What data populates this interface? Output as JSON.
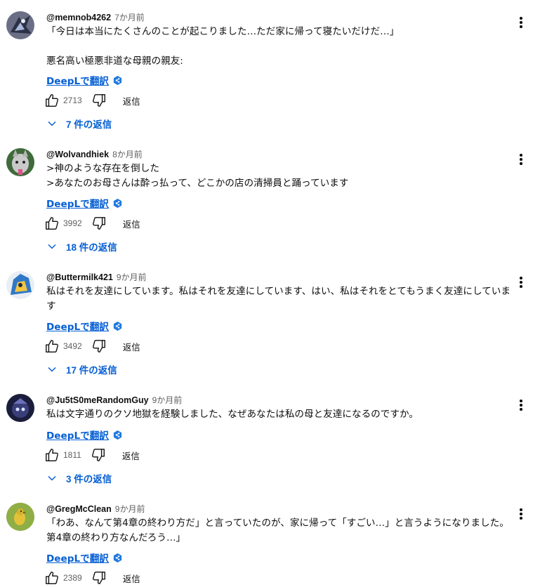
{
  "comments": [
    {
      "author": "@memnob4262",
      "time": "7か月前",
      "text": "「今日は本当にたくさんのことが起こりました…ただ家に帰って寝たいだけだ…」\n\n悪名高い極悪非道な母親の親友:",
      "translate": "DeepLで翻訳",
      "likes": "2713",
      "reply": "返信",
      "replies": "7 件の返信"
    },
    {
      "author": "@Wolvandhiek",
      "time": "8か月前",
      "text": ">神のような存在を倒した\n>あなたのお母さんは酔っ払って、どこかの店の清掃員と踊っています",
      "translate": "DeepLで翻訳",
      "likes": "3992",
      "reply": "返信",
      "replies": "18 件の返信"
    },
    {
      "author": "@Buttermilk421",
      "time": "9か月前",
      "text": "私はそれを友達にしています。私はそれを友達にしています、はい、私はそれをとてもうまく友達にしています",
      "translate": "DeepLで翻訳",
      "likes": "3492",
      "reply": "返信",
      "replies": "17 件の返信"
    },
    {
      "author": "@Ju5tS0meRandomGuy",
      "time": "9か月前",
      "text": "私は文字通りのクソ地獄を経験しました、なぜあなたは私の母と友達になるのですか。",
      "translate": "DeepLで翻訳",
      "likes": "1811",
      "reply": "返信",
      "replies": "3 件の返信"
    },
    {
      "author": "@GregMcClean",
      "time": "9か月前",
      "text": "「わあ、なんて第4章の終わり方だ」と言っていたのが、家に帰って「すごい…」と言うようになりました。第4章の終わり方なんだろう…」",
      "translate": "DeepLで翻訳",
      "likes": "2389",
      "reply": "返信"
    }
  ],
  "colors": {
    "link": "#065fd4",
    "secondary_text": "#606060",
    "primary_text": "#0f0f0f"
  },
  "icons": [
    "avatar",
    "deepl-badge-icon",
    "thumb-up-icon",
    "thumb-down-icon",
    "chevron-down-icon",
    "more-vert-icon"
  ]
}
